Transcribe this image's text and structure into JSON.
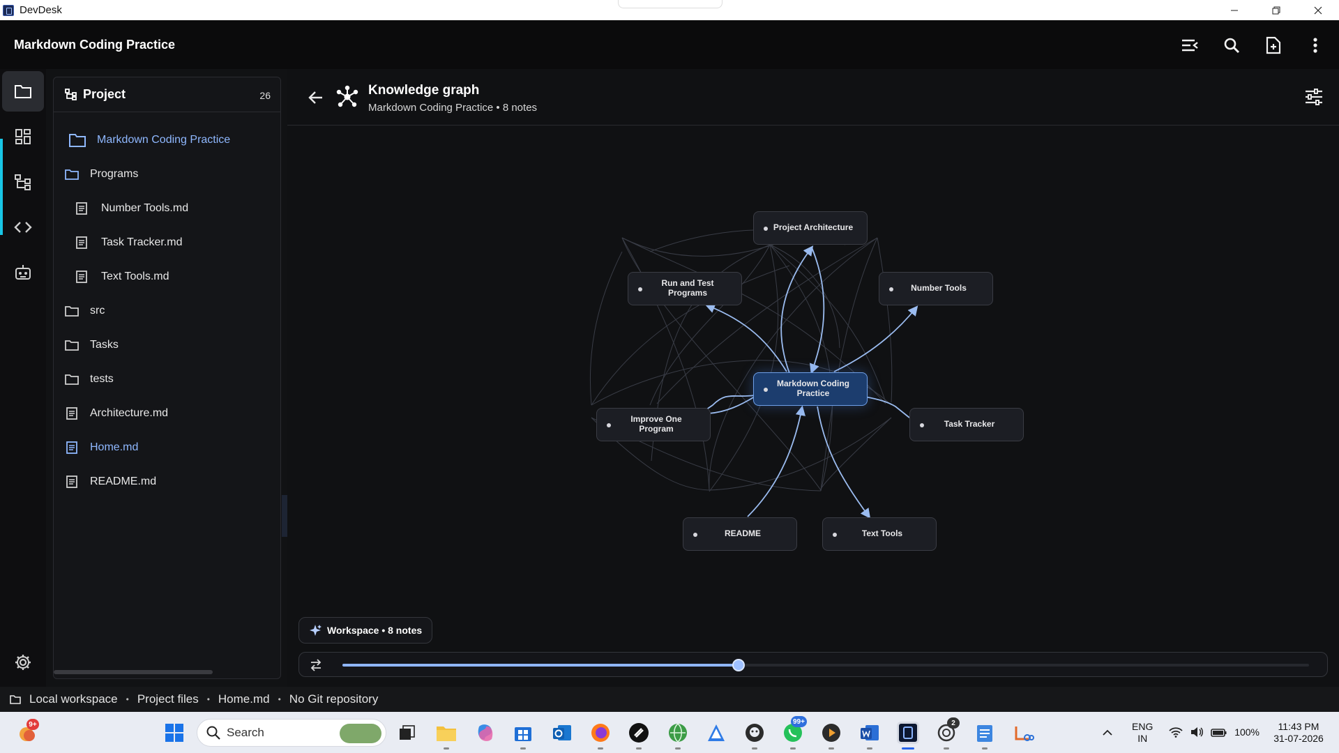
{
  "window": {
    "title": "DevDesk"
  },
  "app": {
    "title": "Markdown Coding Practice"
  },
  "rail": {
    "items": [
      {
        "name": "explorer",
        "icon": "folder-icon",
        "active": true
      },
      {
        "name": "dashboard",
        "icon": "dashboard-icon"
      },
      {
        "name": "project-tree",
        "icon": "tree-icon"
      },
      {
        "name": "code",
        "icon": "code-icon"
      },
      {
        "name": "assistant",
        "icon": "robot-icon"
      }
    ],
    "settings_icon": "gear-icon"
  },
  "project": {
    "title": "Project",
    "count": "26",
    "items": [
      {
        "label": "Markdown Coding Practice",
        "type": "root-folder",
        "highlight": true
      },
      {
        "label": "Programs",
        "type": "folder"
      },
      {
        "label": "Number Tools.md",
        "type": "file",
        "indent": true
      },
      {
        "label": "Task Tracker.md",
        "type": "file",
        "indent": true
      },
      {
        "label": "Text Tools.md",
        "type": "file",
        "indent": true
      },
      {
        "label": "src",
        "type": "folder"
      },
      {
        "label": "Tasks",
        "type": "folder"
      },
      {
        "label": "tests",
        "type": "folder"
      },
      {
        "label": "Architecture.md",
        "type": "file"
      },
      {
        "label": "Home.md",
        "type": "file",
        "highlight": true
      },
      {
        "label": "README.md",
        "type": "file"
      }
    ]
  },
  "graph": {
    "title": "Knowledge graph",
    "subtitle": "Markdown Coding Practice • 8 notes",
    "nodes": [
      {
        "id": "arch",
        "label": "Project Architecture"
      },
      {
        "id": "run",
        "label": "Run and Test Programs"
      },
      {
        "id": "num",
        "label": "Number Tools"
      },
      {
        "id": "center",
        "label": "Markdown Coding Practice",
        "center": true
      },
      {
        "id": "improve",
        "label": "Improve One Program"
      },
      {
        "id": "task",
        "label": "Task Tracker"
      },
      {
        "id": "readme",
        "label": "README"
      },
      {
        "id": "text",
        "label": "Text Tools"
      }
    ],
    "workspace_label": "Workspace • 8 notes",
    "slider_fraction": 0.41
  },
  "status": {
    "workspace": "Local workspace",
    "files": "Project files",
    "current_file": "Home.md",
    "git": "No Git repository"
  },
  "taskbar": {
    "search_placeholder": "Search",
    "weather_badge": "9+",
    "whatsapp_badge": "99+",
    "chatgpt_badge": "2",
    "lang_line1": "ENG",
    "lang_line2": "IN",
    "battery": "100%",
    "time": "11:43 PM",
    "date": "31-07-2026"
  },
  "colors": {
    "accent": "#18c6e6",
    "link_blue": "#8fb8ff",
    "center_node": "#1c3d6e"
  }
}
